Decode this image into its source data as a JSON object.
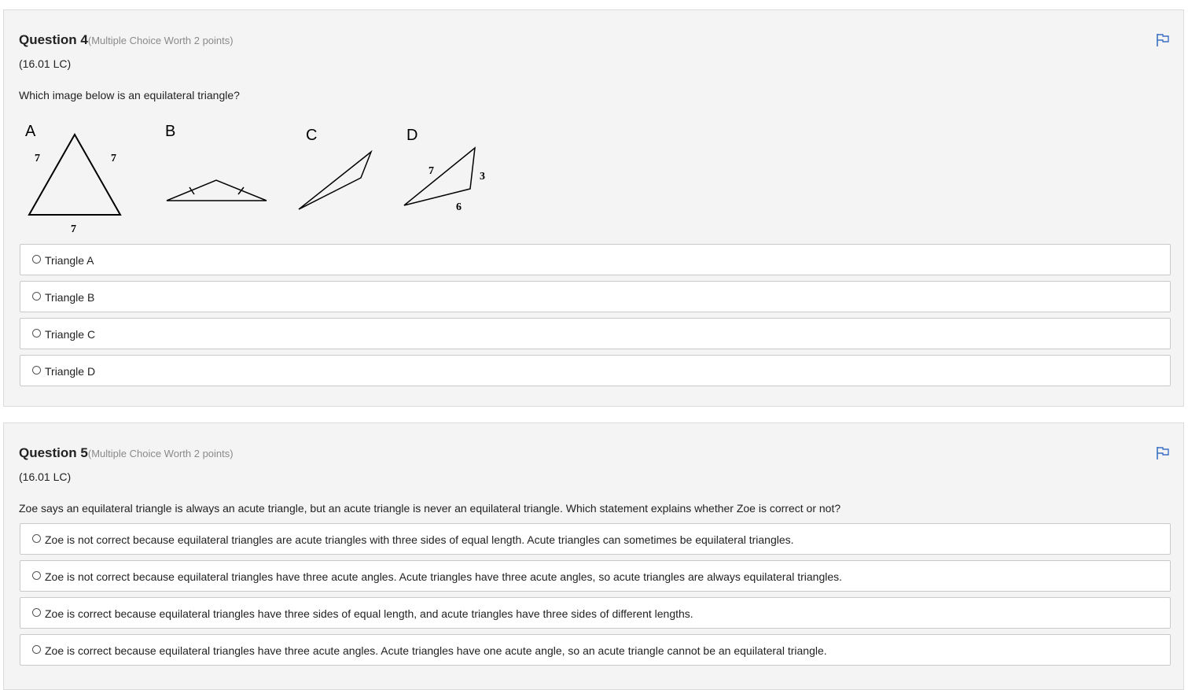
{
  "q4": {
    "title": "Question 4",
    "worth": "(Multiple Choice Worth 2 points)",
    "code": "(16.01 LC)",
    "text": "Which image below is an equilateral triangle?",
    "figure": {
      "labels": [
        "A",
        "B",
        "C",
        "D"
      ],
      "triangle_a_sides": [
        "7",
        "7",
        "7"
      ],
      "triangle_d_sides": [
        "7",
        "3",
        "6"
      ]
    },
    "options": [
      "Triangle A",
      "Triangle B",
      "Triangle C",
      "Triangle D"
    ]
  },
  "q5": {
    "title": "Question 5",
    "worth": "(Multiple Choice Worth 2 points)",
    "code": "(16.01 LC)",
    "text": "Zoe says an equilateral triangle is always an acute triangle, but an acute triangle is never an equilateral triangle. Which statement explains whether Zoe is correct or not?",
    "options": [
      "Zoe is not correct because equilateral triangles are acute triangles with three sides of equal length. Acute triangles can sometimes be equilateral triangles.",
      "Zoe is not correct because equilateral triangles have three acute angles. Acute triangles have three acute angles, so acute triangles are always equilateral triangles.",
      "Zoe is correct because equilateral triangles have three sides of equal length, and acute triangles have three sides of different lengths.",
      "Zoe is correct because equilateral triangles have three acute angles. Acute triangles have one acute angle, so an acute triangle cannot be an equilateral triangle."
    ]
  },
  "icons": {
    "flag": "flag-icon",
    "radio": "radio-unchecked-icon"
  },
  "colors": {
    "flag": "#3a6fc4",
    "card_bg": "#f4f4f4",
    "option_bg": "#ffffff"
  }
}
